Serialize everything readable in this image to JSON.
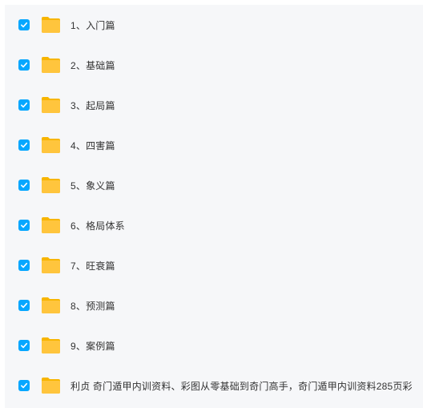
{
  "colors": {
    "accent": "#06a7ff",
    "folder": "#ffc53d",
    "panel_bg": "#f6f7f9",
    "text": "#333333"
  },
  "files": [
    {
      "name": "1、入门篇",
      "checked": true,
      "icon": "folder-icon"
    },
    {
      "name": "2、基础篇",
      "checked": true,
      "icon": "folder-icon"
    },
    {
      "name": "3、起局篇",
      "checked": true,
      "icon": "folder-icon"
    },
    {
      "name": "4、四害篇",
      "checked": true,
      "icon": "folder-icon"
    },
    {
      "name": "5、象义篇",
      "checked": true,
      "icon": "folder-icon"
    },
    {
      "name": "6、格局体系",
      "checked": true,
      "icon": "folder-icon"
    },
    {
      "name": "7、旺衰篇",
      "checked": true,
      "icon": "folder-icon"
    },
    {
      "name": "8、预测篇",
      "checked": true,
      "icon": "folder-icon"
    },
    {
      "name": "9、案例篇",
      "checked": true,
      "icon": "folder-icon"
    },
    {
      "name": "利贞 奇门遁甲内训资料、彩图从零基础到奇门高手，奇门遁甲内训资料285页彩",
      "checked": true,
      "icon": "folder-icon"
    }
  ]
}
